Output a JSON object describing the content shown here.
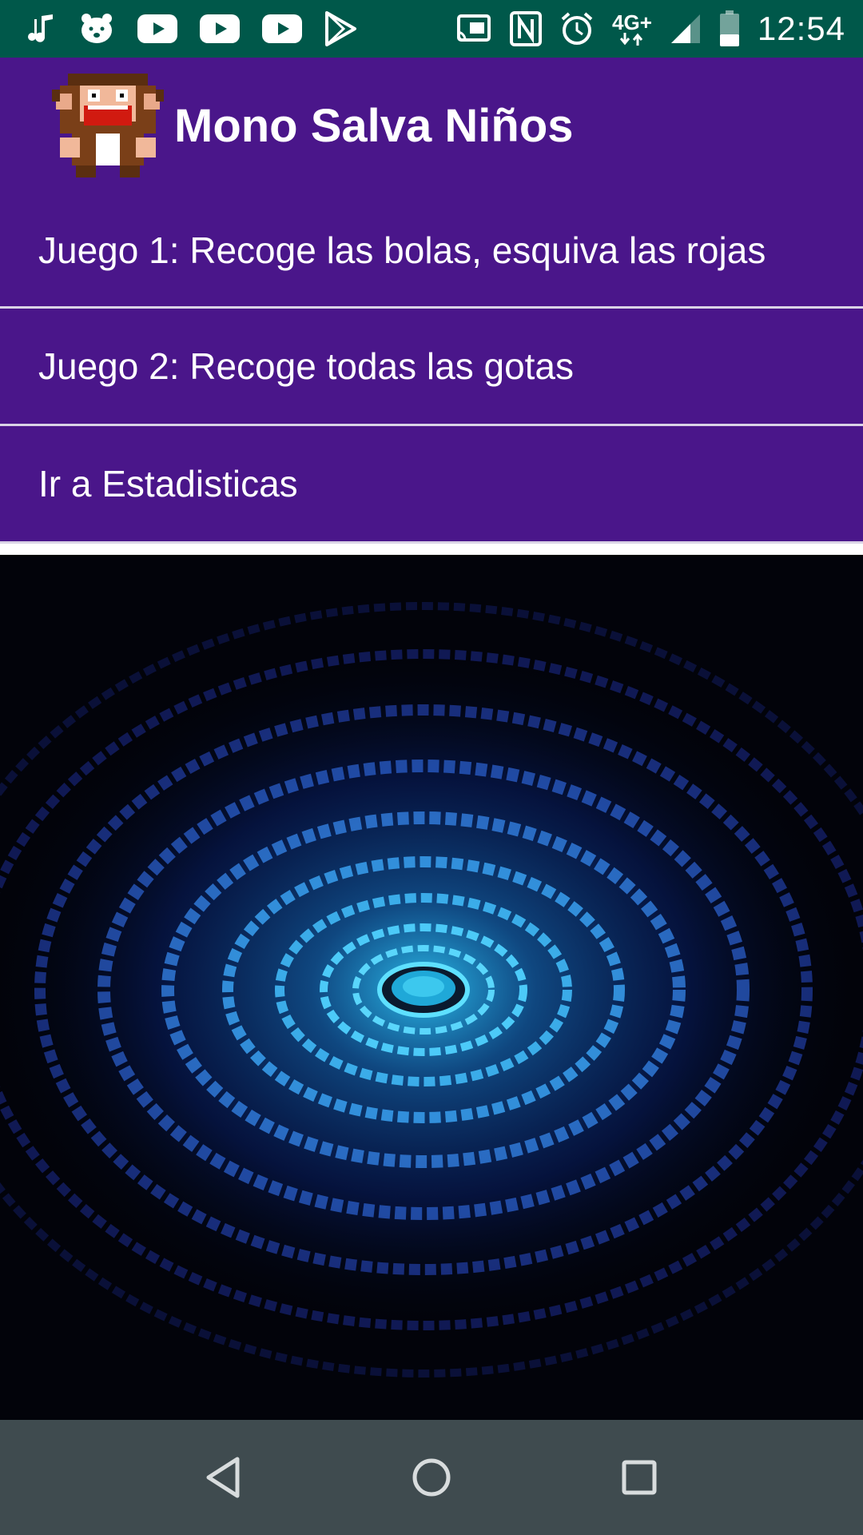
{
  "status_bar": {
    "time": "12:54",
    "network": "4G+",
    "left_icons": [
      "music-note-icon",
      "hamster-app-icon",
      "youtube-icon",
      "youtube-icon",
      "youtube-icon",
      "play-store-icon"
    ],
    "right_icons": [
      "cast-icon",
      "nfc-icon",
      "alarm-icon",
      "network-4g-icon",
      "signal-icon",
      "battery-icon"
    ],
    "color": "#00584a"
  },
  "app_bar": {
    "title": "Mono Salva Niños",
    "logo": "monkey-logo",
    "color": "#4a168a"
  },
  "menu": {
    "items": [
      {
        "label": "Juego 1: Recoge las bolas, esquiva las rojas"
      },
      {
        "label": "Juego 2: Recoge todas las gotas"
      },
      {
        "label": "Ir a Estadisticas"
      }
    ]
  },
  "background": {
    "image": "blue-radial-tunnel-art"
  },
  "nav_bar": {
    "buttons": [
      "back-icon",
      "home-icon",
      "recents-icon"
    ],
    "color": "#3f4b4f"
  }
}
